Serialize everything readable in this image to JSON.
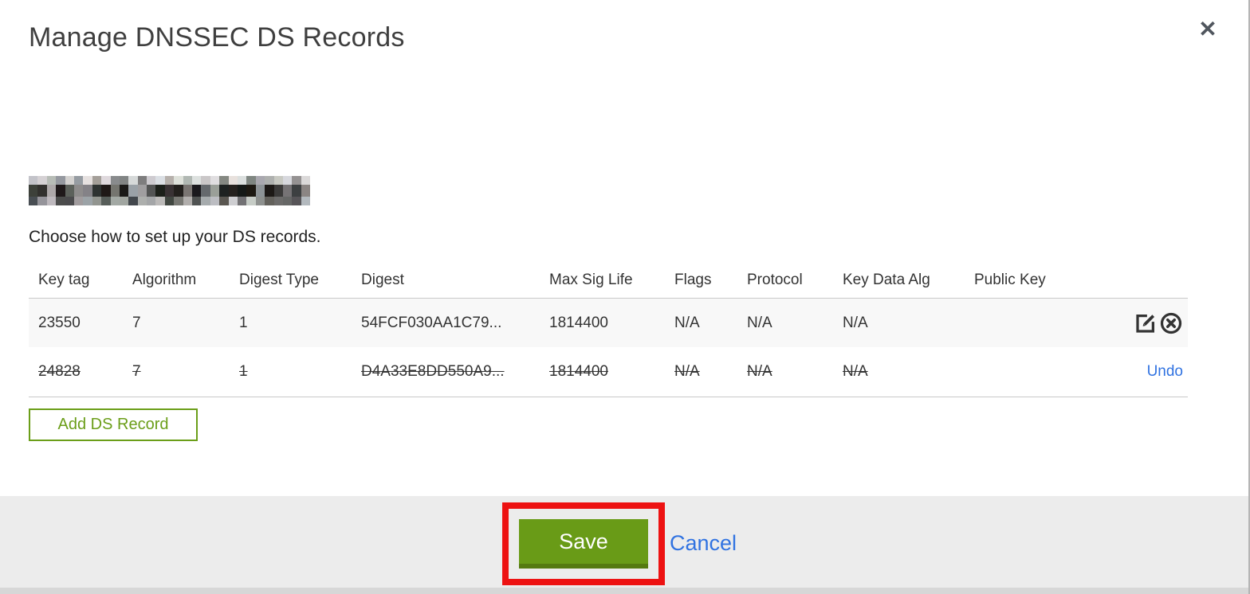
{
  "modal": {
    "title": "Manage DNSSEC DS Records",
    "subtitle": "Choose how to set up your DS records.",
    "add_ds_record_button": "Add DS Record",
    "save_button": "Save",
    "cancel_link": "Cancel"
  },
  "table": {
    "columns": [
      "Key tag",
      "Algorithm",
      "Digest Type",
      "Digest",
      "Max Sig Life",
      "Flags",
      "Protocol",
      "Key Data Alg",
      "Public Key"
    ],
    "rows": [
      {
        "cells": [
          "23550",
          "7",
          "1",
          "54FCF030AA1C79...",
          "1814400",
          "N/A",
          "N/A",
          "N/A",
          ""
        ],
        "deleted": false,
        "actions": "edit-delete"
      },
      {
        "cells": [
          "24828",
          "7",
          "1",
          "D4A33E8DD550A9...",
          "1814400",
          "N/A",
          "N/A",
          "N/A",
          ""
        ],
        "deleted": true,
        "actions": "undo",
        "undo_label": "Undo"
      }
    ]
  },
  "icons": {
    "close": "✕",
    "edit": "edit-pencil-square",
    "delete": "circle-x"
  },
  "colors": {
    "button_green": "#699b17",
    "outline_green": "#6b9e19",
    "link_blue": "#3173e1",
    "annotation_red": "#ed1212",
    "footer_gray": "#ececec"
  }
}
